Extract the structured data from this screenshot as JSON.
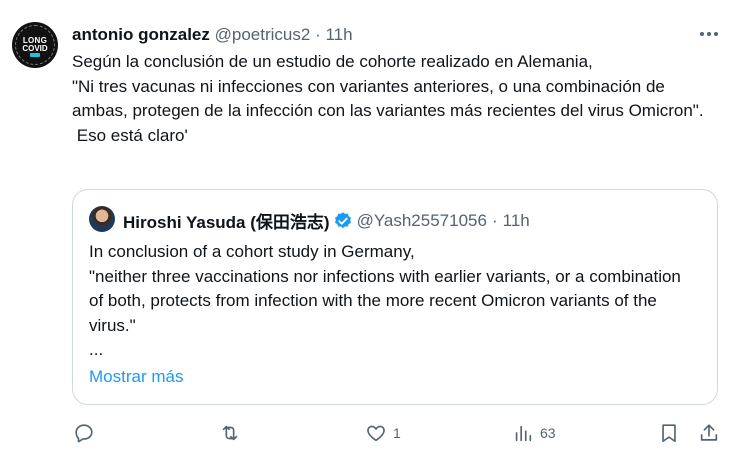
{
  "author": {
    "name": "antonio gonzalez",
    "handle": "@poetricus2",
    "separator": "·",
    "time": "11h",
    "avatar_text_top": "LONG",
    "avatar_text_bottom": "COVID"
  },
  "tweet_text": "Según la conclusión de un estudio de cohorte realizado en Alemania,\n\"Ni tres vacunas ni infecciones con variantes anteriores, o una combinación de ambas, protegen de la infección con las variantes más recientes del virus Omicron\".\n Eso está claro'",
  "quoted": {
    "name": "Hiroshi Yasuda (保田浩志)",
    "handle": "@Yash25571056",
    "separator": "·",
    "time": "11h",
    "text": "In conclusion of a cohort study in Germany,\n\"neither three vaccinations nor infections with earlier variants, or a combination of both, protects from infection with the more recent Omicron variants of the virus.\"\n...",
    "show_more": "Mostrar más"
  },
  "actions": {
    "replies": "",
    "retweets": "",
    "likes": "1",
    "views": "63"
  },
  "icons": {
    "more": "more-dots-icon",
    "verified": "verified-badge-icon",
    "reply": "reply-icon",
    "retweet": "retweet-icon",
    "like": "heart-icon",
    "views": "views-chart-icon",
    "bookmark": "bookmark-icon",
    "share": "share-icon"
  },
  "colors": {
    "link": "#1d9bf0",
    "muted": "#536471",
    "text": "#0f1419",
    "border": "#cfd9de"
  }
}
